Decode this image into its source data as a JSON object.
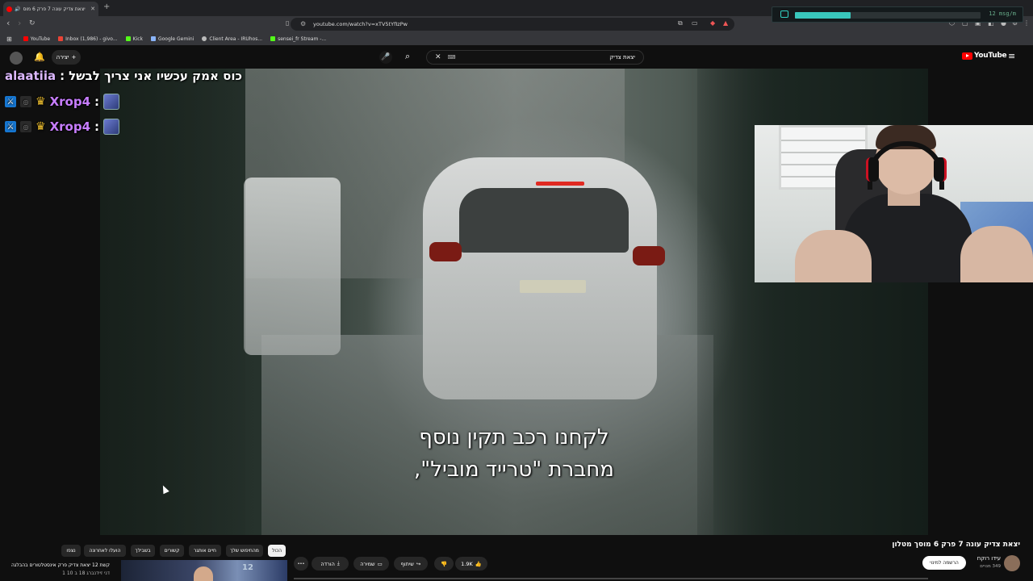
{
  "browser": {
    "tab_title": "יצאת צדיק עונה 7 פרק 6 מוס",
    "url": "youtube.com/watch?v=xTV5tYfIzPw",
    "bookmarks": [
      {
        "label": "YouTube",
        "color": "#ff0000"
      },
      {
        "label": "Inbox (1,986) - givo...",
        "color": "#ea4335"
      },
      {
        "label": "Kick",
        "color": "#53fc18"
      },
      {
        "label": "Google Gemini",
        "color": "#8ab4f8"
      },
      {
        "label": "Client Area - IRUhos...",
        "color": "#bbbbbb"
      },
      {
        "label": "sensei_fr Stream -...",
        "color": "#53fc18"
      }
    ]
  },
  "chat_widget": {
    "rate": "12 msg/m",
    "level_fraction": 0.3
  },
  "yt_header": {
    "create_label": "יצירה",
    "search_query": "יצאת צדיק",
    "logo_text": "YouTube"
  },
  "chat": {
    "top": {
      "user": "alaatiia",
      "sep": ":",
      "message": "כוס אמק עכשיו אני צריך לבשל"
    },
    "rows": [
      {
        "user": "Xrop4",
        "sep": ":"
      },
      {
        "user": "Xrop4",
        "sep": ":"
      }
    ]
  },
  "video": {
    "subtitle_line1": "לקחנו רכב תקין נוסף",
    "subtitle_line2": "מחברת \"טרייד מוביל\","
  },
  "below": {
    "title": "יצאת צדיק עונה 7 פרק 6 מוסך מטלון",
    "channel_name": "עידו רוקח",
    "channel_subs": "349 מנויים",
    "subscribe_label": "הרשמה למינוי",
    "likes": "1.9K",
    "share_label": "שיתוף",
    "save_label": "שמירה",
    "download_label": "הורדה",
    "more_label": "•••",
    "chips": [
      {
        "label": "הכול",
        "active": true
      },
      {
        "label": "מהחיפוש שלך"
      },
      {
        "label": "חיים אותגר"
      },
      {
        "label": "קשורים"
      },
      {
        "label": "בשבילך"
      },
      {
        "label": "הועלו לאחרונה"
      },
      {
        "label": "נצפו"
      }
    ],
    "related_title": "קשת 12 יצאת צדיק פרק אינסטלטורים בהבלגה",
    "related_sub": "דני זיידנברג 18 ב 10 1",
    "related_thumb_text": "12"
  }
}
